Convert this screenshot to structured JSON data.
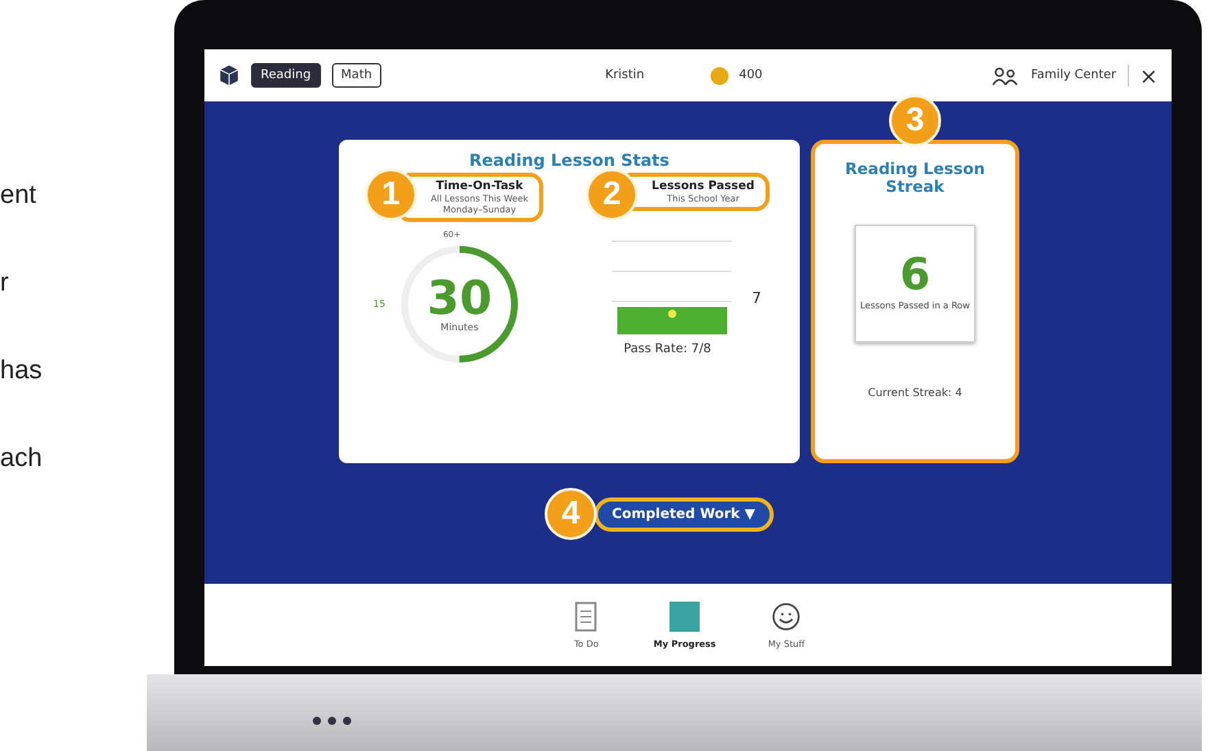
{
  "side_text": [
    "ent",
    "r",
    "has",
    "ach"
  ],
  "top_bar": {
    "subjects": [
      {
        "label": "Reading",
        "selected": true
      },
      {
        "label": "Math",
        "selected": false
      }
    ],
    "student": "Kristin",
    "coins": "400",
    "family_center": "Family Center",
    "close": "×"
  },
  "stats_card": {
    "title": "Reading Lesson Stats",
    "time_on_task": {
      "badge": "1",
      "title": "Time-On-Task",
      "subtitle": "All Lessons This Week",
      "range": "Monday–Sunday",
      "level": 0.5,
      "max_label": "60+",
      "min_label": "15",
      "value": "30",
      "unit": "Minutes"
    },
    "lessons_passed": {
      "badge": "2",
      "title": "Lessons Passed",
      "subtitle": "This School Year",
      "value": "7",
      "pass_rate": "Pass Rate: 7/8"
    }
  },
  "streak_card": {
    "badge": "3",
    "title": "Reading Lesson Streak",
    "value": "6",
    "caption": "Lessons Passed in a Row",
    "current": "Current Streak: 4"
  },
  "completed_work": {
    "badge": "4",
    "label": "Completed Work",
    "caret": "▼"
  },
  "bottom_nav": [
    {
      "label": "To Do",
      "selected": false
    },
    {
      "label": "My Progress",
      "selected": true
    },
    {
      "label": "My Stuff",
      "selected": false
    }
  ]
}
